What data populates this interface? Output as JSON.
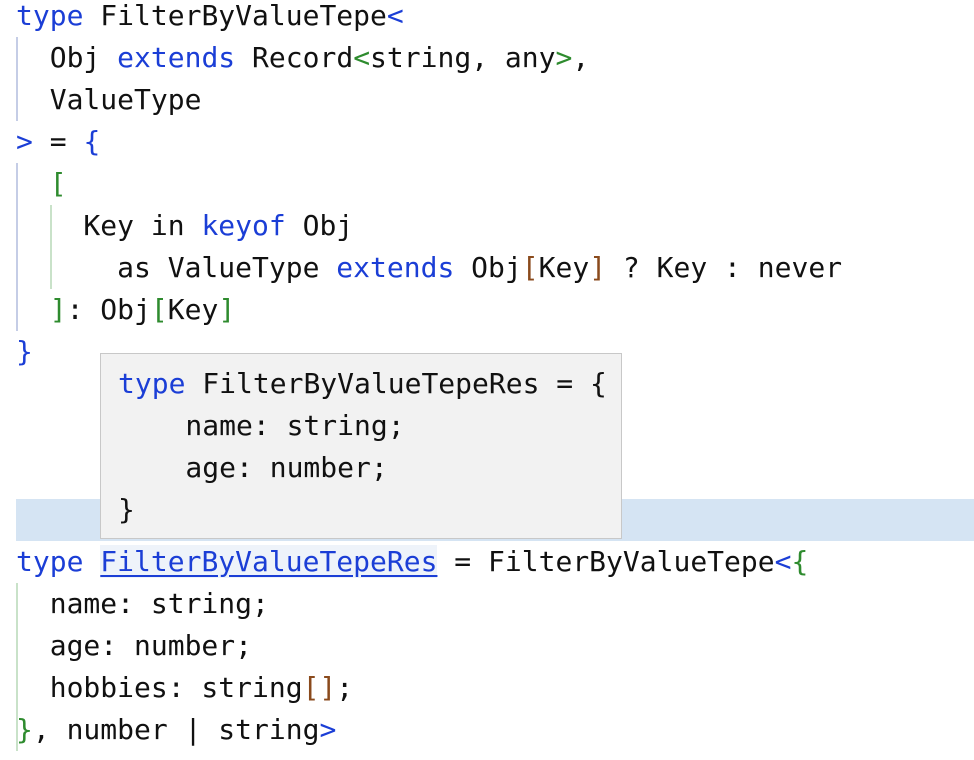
{
  "editor": {
    "lines": [
      [
        {
          "t": "type",
          "c": "kw"
        },
        {
          "t": " FilterByValueTepe",
          "c": "pl"
        },
        {
          "t": "<",
          "c": "kw"
        }
      ],
      [
        {
          "t": "  Obj ",
          "c": "pl"
        },
        {
          "t": "extends",
          "c": "kw"
        },
        {
          "t": " Record",
          "c": "pl"
        },
        {
          "t": "<",
          "c": "gr"
        },
        {
          "t": "string, any",
          "c": "pl"
        },
        {
          "t": ">",
          "c": "gr"
        },
        {
          "t": ",",
          "c": "pl"
        }
      ],
      [
        {
          "t": "  ValueType",
          "c": "pl"
        }
      ],
      [
        {
          "t": ">",
          "c": "kw"
        },
        {
          "t": " = ",
          "c": "pl"
        },
        {
          "t": "{",
          "c": "kw"
        }
      ],
      [
        {
          "t": "  ",
          "c": "pl"
        },
        {
          "t": "[",
          "c": "gr"
        }
      ],
      [
        {
          "t": "    Key in ",
          "c": "pl"
        },
        {
          "t": "keyof",
          "c": "kw"
        },
        {
          "t": " Obj",
          "c": "pl"
        }
      ],
      [
        {
          "t": "      as ValueType ",
          "c": "pl"
        },
        {
          "t": "extends",
          "c": "kw"
        },
        {
          "t": " Obj",
          "c": "pl"
        },
        {
          "t": "[",
          "c": "br"
        },
        {
          "t": "Key",
          "c": "pl"
        },
        {
          "t": "]",
          "c": "br"
        },
        {
          "t": " ? Key : never",
          "c": "pl"
        }
      ],
      [
        {
          "t": "  ",
          "c": "pl"
        },
        {
          "t": "]",
          "c": "gr"
        },
        {
          "t": ": Obj",
          "c": "pl"
        },
        {
          "t": "[",
          "c": "gr"
        },
        {
          "t": "Key",
          "c": "pl"
        },
        {
          "t": "]",
          "c": "gr"
        }
      ],
      [
        {
          "t": "}",
          "c": "kw"
        }
      ],
      [],
      [],
      [],
      [],
      [
        {
          "t": "type",
          "c": "kw"
        },
        {
          "t": " ",
          "c": "pl"
        },
        {
          "t": "FilterByValueTepeRes",
          "c": "ref"
        },
        {
          "t": " = FilterByValueTepe",
          "c": "pl"
        },
        {
          "t": "<",
          "c": "kw"
        },
        {
          "t": "{",
          "c": "gr"
        }
      ],
      [
        {
          "t": "  name: string;",
          "c": "pl"
        }
      ],
      [
        {
          "t": "  age: number;",
          "c": "pl"
        }
      ],
      [
        {
          "t": "  hobbies: string",
          "c": "pl"
        },
        {
          "t": "[]",
          "c": "br"
        },
        {
          "t": ";",
          "c": "pl"
        }
      ],
      [
        {
          "t": "}",
          "c": "gr"
        },
        {
          "t": ", number | string",
          "c": "pl"
        },
        {
          "t": ">",
          "c": "kw"
        }
      ]
    ]
  },
  "tooltip": {
    "lines": [
      [
        {
          "t": "type",
          "c": "kw"
        },
        {
          "t": " FilterByValueTepeRes = {",
          "c": "pl"
        }
      ],
      [
        {
          "t": "    name: string;",
          "c": "pl"
        }
      ],
      [
        {
          "t": "    age: number;",
          "c": "pl"
        }
      ],
      [
        {
          "t": "}",
          "c": "pl"
        }
      ]
    ]
  },
  "colors": {
    "keyword": "#1b3ed6",
    "bracket_green": "#2e8b2e",
    "bracket_brown": "#8a4a1c",
    "line_highlight": "#d5e4f3",
    "tooltip_bg": "#f2f2f2"
  }
}
